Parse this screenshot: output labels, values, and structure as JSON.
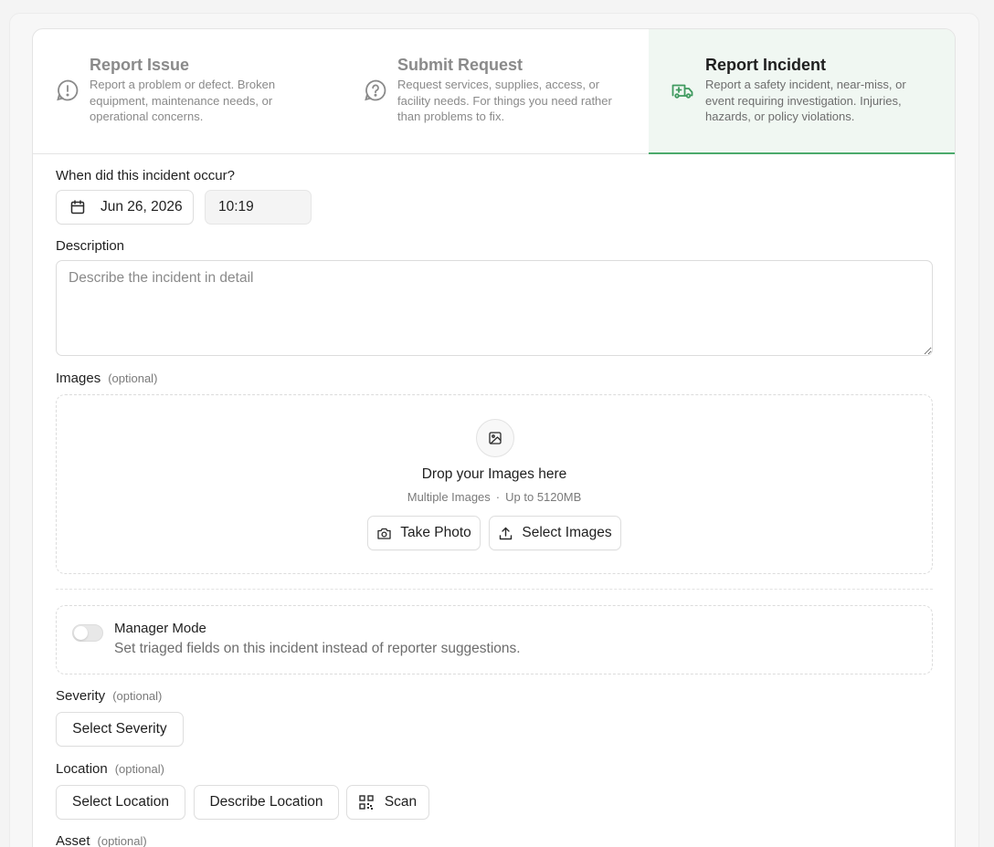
{
  "tabs": [
    {
      "title": "Report Issue",
      "description": "Report a problem or defect. Broken equipment, maintenance needs, or operational concerns.",
      "icon": "alert-circle-icon"
    },
    {
      "title": "Submit Request",
      "description": "Request services, supplies, access, or facility needs. For things you need rather than problems to fix.",
      "icon": "help-circle-icon"
    },
    {
      "title": "Report Incident",
      "description": "Report a safety incident, near-miss, or event requiring investigation. Injuries, hazards, or policy violations.",
      "icon": "ambulance-icon",
      "active": true
    }
  ],
  "when": {
    "label": "When did this incident occur?",
    "date": "Jun 26, 2026",
    "time": "10:19"
  },
  "description": {
    "label": "Description",
    "placeholder": "Describe the incident in detail"
  },
  "images": {
    "label": "Images",
    "optional": "(optional)",
    "drop_title": "Drop your Images here",
    "drop_sub_1": "Multiple Images",
    "drop_sub_sep": "·",
    "drop_sub_2": "Up to 5120MB",
    "take_photo": "Take Photo",
    "select_images": "Select Images"
  },
  "manager_mode": {
    "title": "Manager Mode",
    "description": "Set triaged fields on this incident instead of reporter suggestions.",
    "enabled": false
  },
  "severity": {
    "label": "Severity",
    "optional": "(optional)",
    "button": "Select Severity"
  },
  "location": {
    "label": "Location",
    "optional": "(optional)",
    "select": "Select Location",
    "describe": "Describe Location",
    "scan": "Scan"
  },
  "asset": {
    "label": "Asset",
    "optional": "(optional)"
  },
  "colors": {
    "accent": "#4caa6c",
    "active_tab_bg": "#f0f7f2"
  }
}
